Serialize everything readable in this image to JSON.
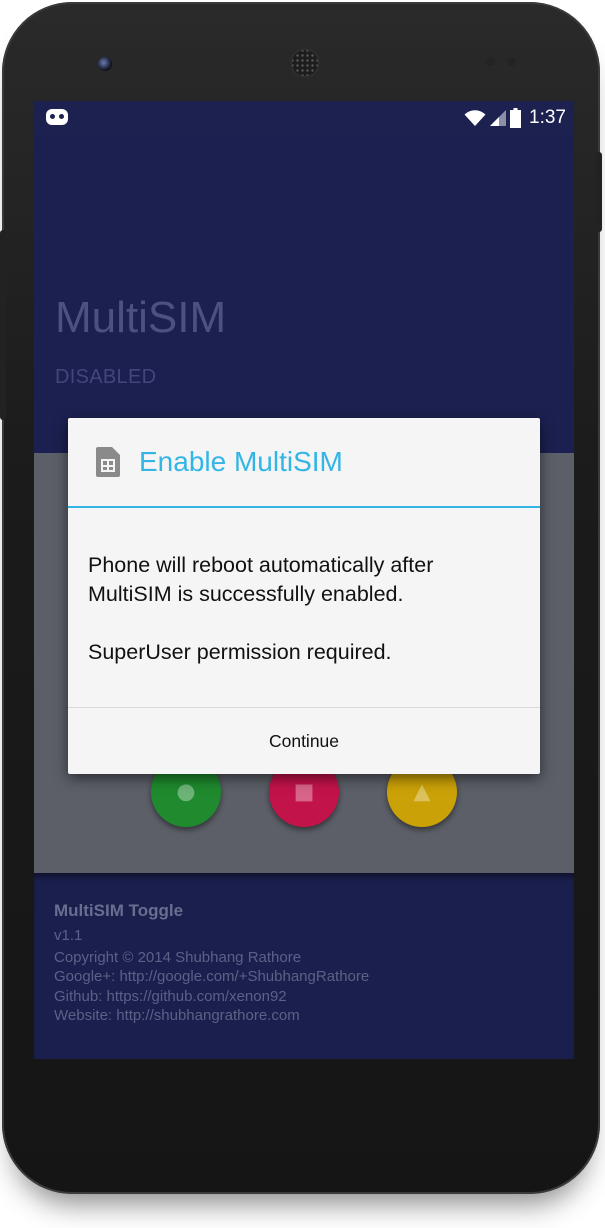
{
  "status_bar": {
    "time": "1:37",
    "icons": [
      "cyanogenmod-icon",
      "wifi-icon",
      "signal-icon",
      "battery-icon"
    ]
  },
  "app": {
    "title": "MultiSIM",
    "status": "DISABLED"
  },
  "fabs": [
    {
      "name": "green-action",
      "color": "#1f8a2e"
    },
    {
      "name": "pink-action",
      "color": "#c2134a"
    },
    {
      "name": "yellow-action",
      "color": "#caa107"
    }
  ],
  "footer": {
    "title": "MultiSIM Toggle",
    "lines": [
      "v1.1",
      "Copyright © 2014 Shubhang Rathore",
      "Google+: http://google.com/+ShubhangRathore",
      "Github: https://github.com/xenon92",
      "Website: http://shubhangrathore.com"
    ]
  },
  "dialog": {
    "icon": "sim-card-icon",
    "title": "Enable MultiSIM",
    "message": "Phone will reboot automatically after\nMultiSIM is successfully enabled.\n\nSuperUser permission required.",
    "button": "Continue",
    "accent_color": "#33b5e5"
  }
}
